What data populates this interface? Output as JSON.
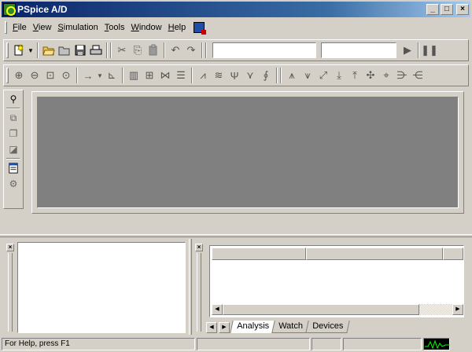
{
  "window": {
    "title": "PSpice A/D",
    "controls": [
      "minimize-icon",
      "maximize-icon",
      "close-icon"
    ]
  },
  "menu": {
    "items": [
      "File",
      "View",
      "Simulation",
      "Tools",
      "Window",
      "Help"
    ],
    "doc_icon": "document-icon"
  },
  "toolbar1": {
    "buttons": [
      "new-icon",
      "dropdown-icon",
      "open-folder-icon",
      "open-file-icon",
      "save-icon",
      "print-icon",
      "cut-icon",
      "copy-icon",
      "paste-icon",
      "undo-icon",
      "redo-icon"
    ],
    "sim_profile_value": "",
    "sim_combo2_value": "",
    "run_icon": "play-icon",
    "pause_icon": "pause-icon"
  },
  "toolbar2": {
    "buttons": [
      "zoom-in-icon",
      "zoom-out-icon",
      "zoom-area-icon",
      "zoom-fit-icon",
      "arrow-icon",
      "dropdown-icon",
      "axis-icon",
      "columns-icon",
      "add-plot-icon",
      "cursor-icon",
      "table-icon",
      "trace-icon",
      "fourier-icon",
      "label-icon",
      "mark-icon",
      "eval-icon",
      "peak-icon",
      "trough-icon",
      "slope-icon",
      "min-icon",
      "max-icon",
      "point-icon",
      "search-icon",
      "next-icon",
      "prev-icon"
    ]
  },
  "vtoolbar": {
    "buttons": [
      "probe-icon",
      "tile-icon",
      "cascade-icon",
      "copy-window-icon",
      "output-file-icon",
      "settings-icon"
    ]
  },
  "tabs": [
    "Analysis",
    "Watch",
    "Devices"
  ],
  "status": {
    "help_text": "For Help, press F1"
  }
}
